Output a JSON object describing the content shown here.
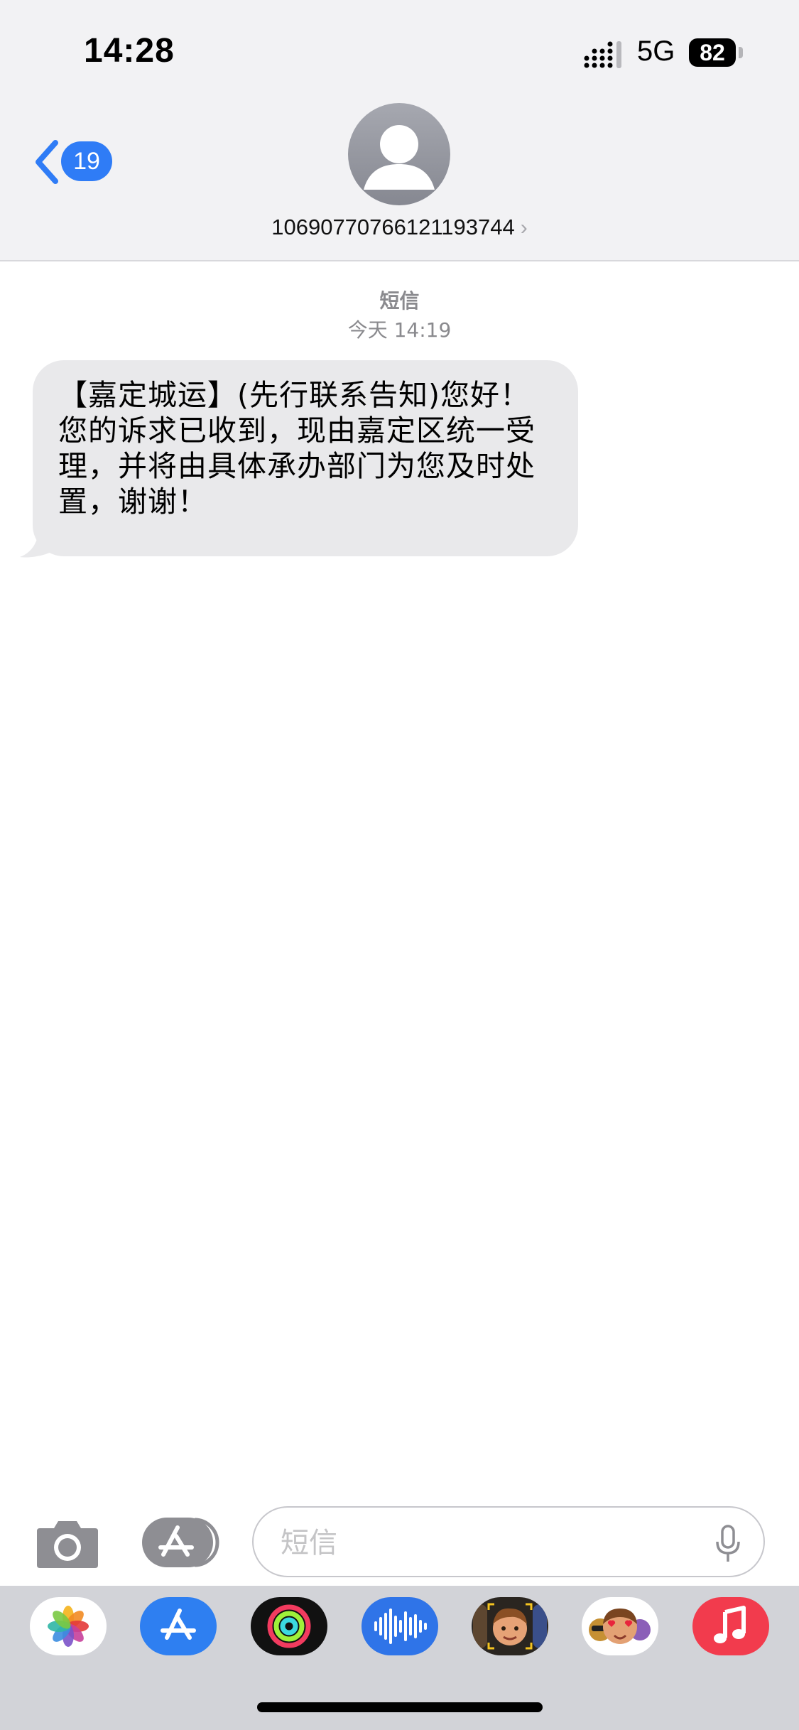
{
  "status_bar": {
    "time": "14:28",
    "network": "5G",
    "battery": "82"
  },
  "nav": {
    "back_count": "19",
    "contact": "106907707661211937​44"
  },
  "conversation": {
    "service": "短信",
    "date_label": "今天",
    "time": "14:19",
    "message": "【嘉定城运】(先行联系告知)您好！您的诉求已收到，现由嘉定区统一受理，并将由具体承办部门为您及时处置，谢谢！"
  },
  "input": {
    "placeholder": "短信"
  },
  "apps": [
    {
      "icon": "photos-icon"
    },
    {
      "icon": "app-store-icon"
    },
    {
      "icon": "activity-icon"
    },
    {
      "icon": "audio-message-icon"
    },
    {
      "icon": "memoji-icon"
    },
    {
      "icon": "memoji-stickers-icon"
    },
    {
      "icon": "music-icon"
    }
  ],
  "colors": {
    "accent": "#2f7cf6",
    "bubble": "#e9e9eb",
    "header_bg": "#f2f2f4",
    "music_red": "#f23b4d"
  }
}
